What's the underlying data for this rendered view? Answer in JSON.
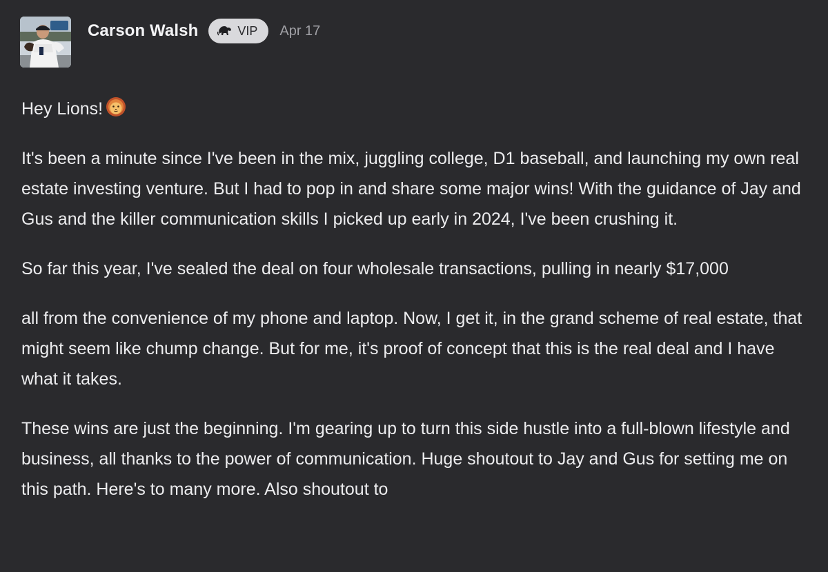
{
  "post": {
    "author": "Carson Walsh",
    "badge_label": "VIP",
    "badge_icon": "lion-icon",
    "date": "Apr 17",
    "greeting": "Hey Lions!",
    "greeting_emoji": "lion-face-emoji",
    "paragraphs": [
      "It's been a minute since I've been in the mix, juggling college, D1 baseball, and launching my own real estate investing venture. But I had to pop in and share some major wins! With the guidance of Jay and Gus and the killer communication skills I picked up early in 2024, I've been crushing it.",
      "So far this year, I've sealed the deal on four wholesale transactions, pulling in nearly $17,000",
      "all from the convenience of my phone and laptop. Now, I get it, in the grand scheme of real estate, that might seem like chump change. But for me, it's proof of concept that this is the real deal and I have what it takes.",
      "These wins are just the beginning. I'm gearing up to turn this side hustle into a full-blown lifestyle and business, all thanks to the power of communication. Huge shoutout to Jay and Gus for setting me on this path. Here's to many more. Also shoutout to"
    ]
  },
  "colors": {
    "background": "#2a2a2d",
    "text": "#ececee",
    "badge_bg": "#d9d9dc",
    "date": "#a1a1a6"
  }
}
